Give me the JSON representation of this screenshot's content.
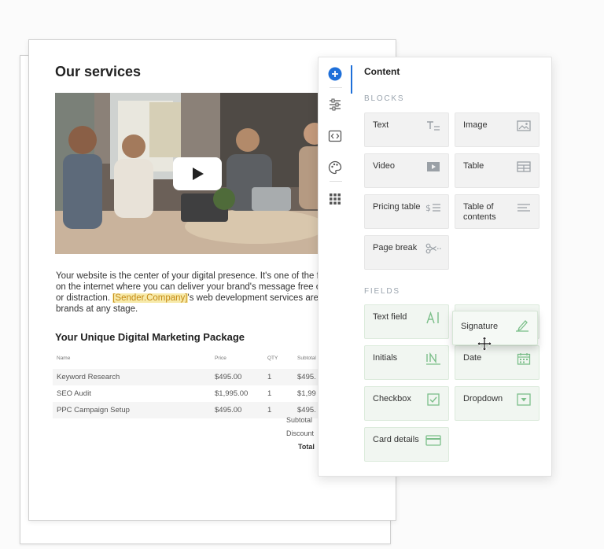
{
  "document": {
    "title": "Our services",
    "paragraph_lines": [
      "Your website is the center of your digital presence. It's one of the few",
      "on the internet where you can deliver your brand's message free of",
      "or distraction. ",
      "'s web development services are p",
      "brands at any stage."
    ],
    "token_text": "[Sender.Company]",
    "package_title": "Your Unique Digital Marketing Package",
    "table": {
      "headers": [
        "Name",
        "Price",
        "QTY",
        "Subtotal"
      ],
      "rows": [
        [
          "Keyword Research",
          "$495.00",
          "1",
          "$495."
        ],
        [
          "SEO Audit",
          "$1,995.00",
          "1",
          "$1,99"
        ],
        [
          "PPC Campaign Setup",
          "$495.00",
          "1",
          "$495."
        ]
      ]
    },
    "totals": {
      "subtotal_label": "Subtotal",
      "discount_label": "Discount",
      "total_label": "Total"
    }
  },
  "panel": {
    "title": "Content",
    "rail_icons": [
      "add-icon",
      "sliders-icon",
      "embed-icon",
      "palette-icon",
      "grid-icon"
    ],
    "blocks_label": "BLOCKS",
    "blocks": [
      {
        "label": "Text",
        "icon": "text-icon"
      },
      {
        "label": "Image",
        "icon": "image-icon"
      },
      {
        "label": "Video",
        "icon": "video-icon"
      },
      {
        "label": "Table",
        "icon": "table-icon"
      },
      {
        "label": "Pricing table",
        "icon": "pricing-table-icon"
      },
      {
        "label": "Table of contents",
        "icon": "toc-icon"
      },
      {
        "label": "Page break",
        "icon": "scissors-icon"
      }
    ],
    "fields_label": "FIELDS",
    "fields": [
      {
        "label": "Text field",
        "icon": "text-field-icon"
      },
      {
        "label": "Signature",
        "icon": "signature-icon"
      },
      {
        "label": "Initials",
        "icon": "initials-icon"
      },
      {
        "label": "Date",
        "icon": "calendar-icon"
      },
      {
        "label": "Checkbox",
        "icon": "checkbox-icon"
      },
      {
        "label": "Dropdown",
        "icon": "dropdown-icon"
      },
      {
        "label": "Card details",
        "icon": "card-icon"
      }
    ],
    "colors": {
      "accent": "#1e6fd9",
      "field_green": "#7cbf8a",
      "block_icon": "#9aa0a6"
    }
  }
}
